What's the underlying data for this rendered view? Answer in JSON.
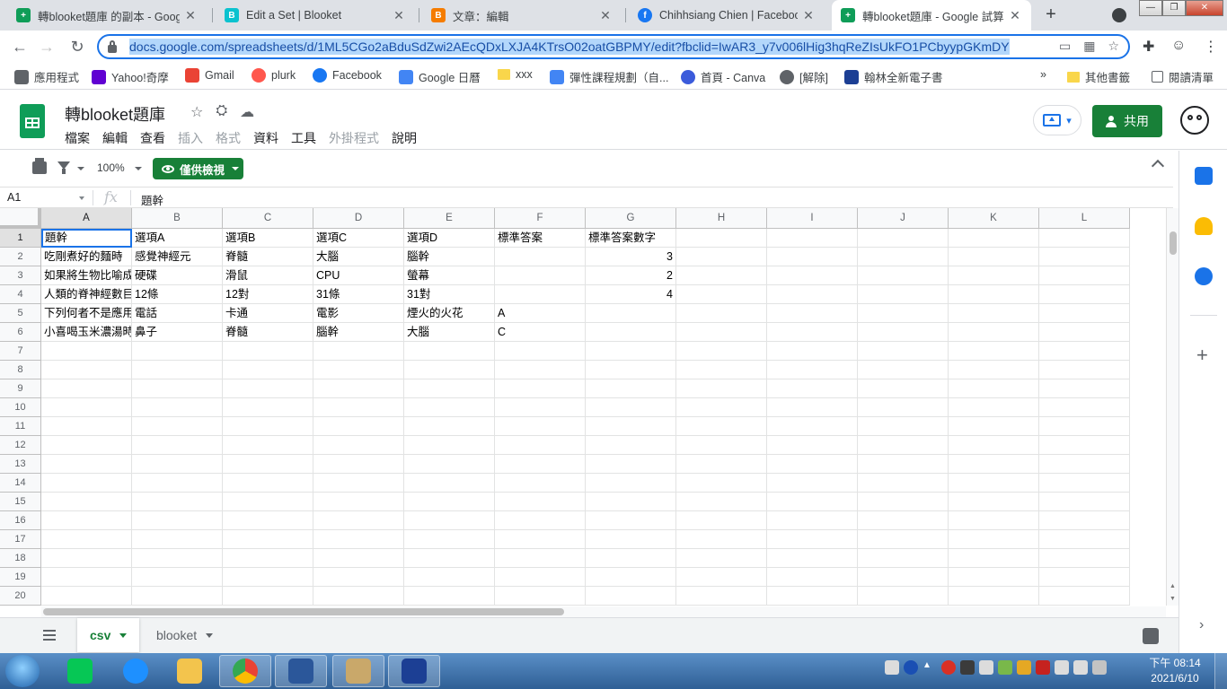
{
  "browser": {
    "tabs": [
      {
        "title": "轉blooket題庫 的副本 - Google",
        "favicon_color": "#0f9d58",
        "favicon_glyph": "+"
      },
      {
        "title": "Edit a Set | Blooket",
        "favicon_color": "#0bc2cf",
        "favicon_glyph": "B"
      },
      {
        "title": "文章：編輯",
        "favicon_color": "#f57c00",
        "favicon_glyph": "B"
      },
      {
        "title": "Chihhsiang Chien | Facebook",
        "favicon_color": "#1877f2",
        "favicon_glyph": "f"
      },
      {
        "title": "轉blooket題庫 - Google 試算表",
        "favicon_color": "#0f9d58",
        "favicon_glyph": "+"
      }
    ],
    "tab_close_glyph": "✕",
    "new_tab_glyph": "+",
    "url": "docs.google.com/spreadsheets/d/1ML5CGo2aBduSdZwi2AEcQDxLXJA4KTrsO02oatGBPMY/edit?fbclid=IwAR3_y7v006lHig3hqReZIsUkFO1PCbyypGKmDY",
    "bookmarks": [
      {
        "label": "應用程式",
        "icon": "apps-grid-icon",
        "color": "#5f6368"
      },
      {
        "label": "Yahoo!奇摩",
        "icon": "yahoo-icon",
        "color": "#6001d2"
      },
      {
        "label": "Gmail",
        "icon": "gmail-icon",
        "color": "#ea4335"
      },
      {
        "label": "plurk",
        "icon": "plurk-icon",
        "color": "#ff574d"
      },
      {
        "label": "Facebook",
        "icon": "facebook-icon",
        "color": "#1877f2"
      },
      {
        "label": "Google 日曆",
        "icon": "calendar-icon",
        "color": "#4285f4"
      },
      {
        "label": "xxx",
        "icon": "folder-icon",
        "color": "#f9d64b"
      },
      {
        "label": "彈性課程規劃（自...",
        "icon": "page-icon",
        "color": "#4285f4"
      },
      {
        "label": "首頁 - Canva",
        "icon": "canva-icon",
        "color": "#3b5bdb"
      },
      {
        "label": "[解除]",
        "icon": "globe-icon",
        "color": "#5f6368"
      },
      {
        "label": "翰林全新電子書",
        "icon": "hanlin-icon",
        "color": "#1c3f94"
      }
    ],
    "bookmarks_more": "»",
    "other_bookmarks": "其他書籤",
    "reading_list": "閱讀清單"
  },
  "sheets": {
    "doc_title": "轉blooket題庫",
    "menu": [
      {
        "label": "檔案",
        "enabled": true
      },
      {
        "label": "編輯",
        "enabled": true
      },
      {
        "label": "查看",
        "enabled": true
      },
      {
        "label": "插入",
        "enabled": false
      },
      {
        "label": "格式",
        "enabled": false
      },
      {
        "label": "資料",
        "enabled": true
      },
      {
        "label": "工具",
        "enabled": true
      },
      {
        "label": "外掛程式",
        "enabled": false
      },
      {
        "label": "說明",
        "enabled": true
      }
    ],
    "share_label": "共用",
    "zoom": "100%",
    "view_only_label": "僅供檢視",
    "name_box": "A1",
    "fx_label": "fx",
    "formula_value": "題幹",
    "accent_color": "#188038",
    "selection_color": "#1a73e8"
  },
  "grid": {
    "columns": [
      "A",
      "B",
      "C",
      "D",
      "E",
      "F",
      "G",
      "H",
      "I",
      "J",
      "K",
      "L"
    ],
    "row_numbers": [
      "1",
      "2",
      "3",
      "4",
      "5",
      "6",
      "7",
      "8",
      "9",
      "10",
      "11",
      "12",
      "13",
      "14",
      "15",
      "16",
      "17",
      "18",
      "19",
      "20"
    ],
    "rows": [
      [
        "題幹",
        "選項A",
        "選項B",
        "選項C",
        "選項D",
        "標準答案",
        "標準答案數字"
      ],
      [
        "吃剛煮好的麵時",
        "感覺神經元",
        "脊髓",
        "大腦",
        "腦幹",
        "",
        "3"
      ],
      [
        "如果將生物比喻成",
        "硬碟",
        "滑鼠",
        "CPU",
        "螢幕",
        "",
        "2"
      ],
      [
        "人類的脊神經數目",
        "12條",
        "12對",
        "31條",
        "31對",
        "",
        "4"
      ],
      [
        "下列何者不是應用",
        "電話",
        "卡通",
        "電影",
        "煙火的火花",
        "A",
        ""
      ],
      [
        "小喜喝玉米濃湯時",
        "鼻子",
        "脊髓",
        "腦幹",
        "大腦",
        "C",
        ""
      ]
    ],
    "numeric_columns": [
      6
    ],
    "active_cell": "A1"
  },
  "sheet_tabs": [
    {
      "label": "csv",
      "active": true
    },
    {
      "label": "blooket",
      "active": false
    }
  ],
  "taskbar": {
    "apps": [
      "LINE",
      "Internet Explorer",
      "File Explorer",
      "Google Chrome",
      "Microsoft Word",
      "Paint",
      "翰林"
    ],
    "time": "下午 08:14",
    "date": "2021/6/10"
  }
}
